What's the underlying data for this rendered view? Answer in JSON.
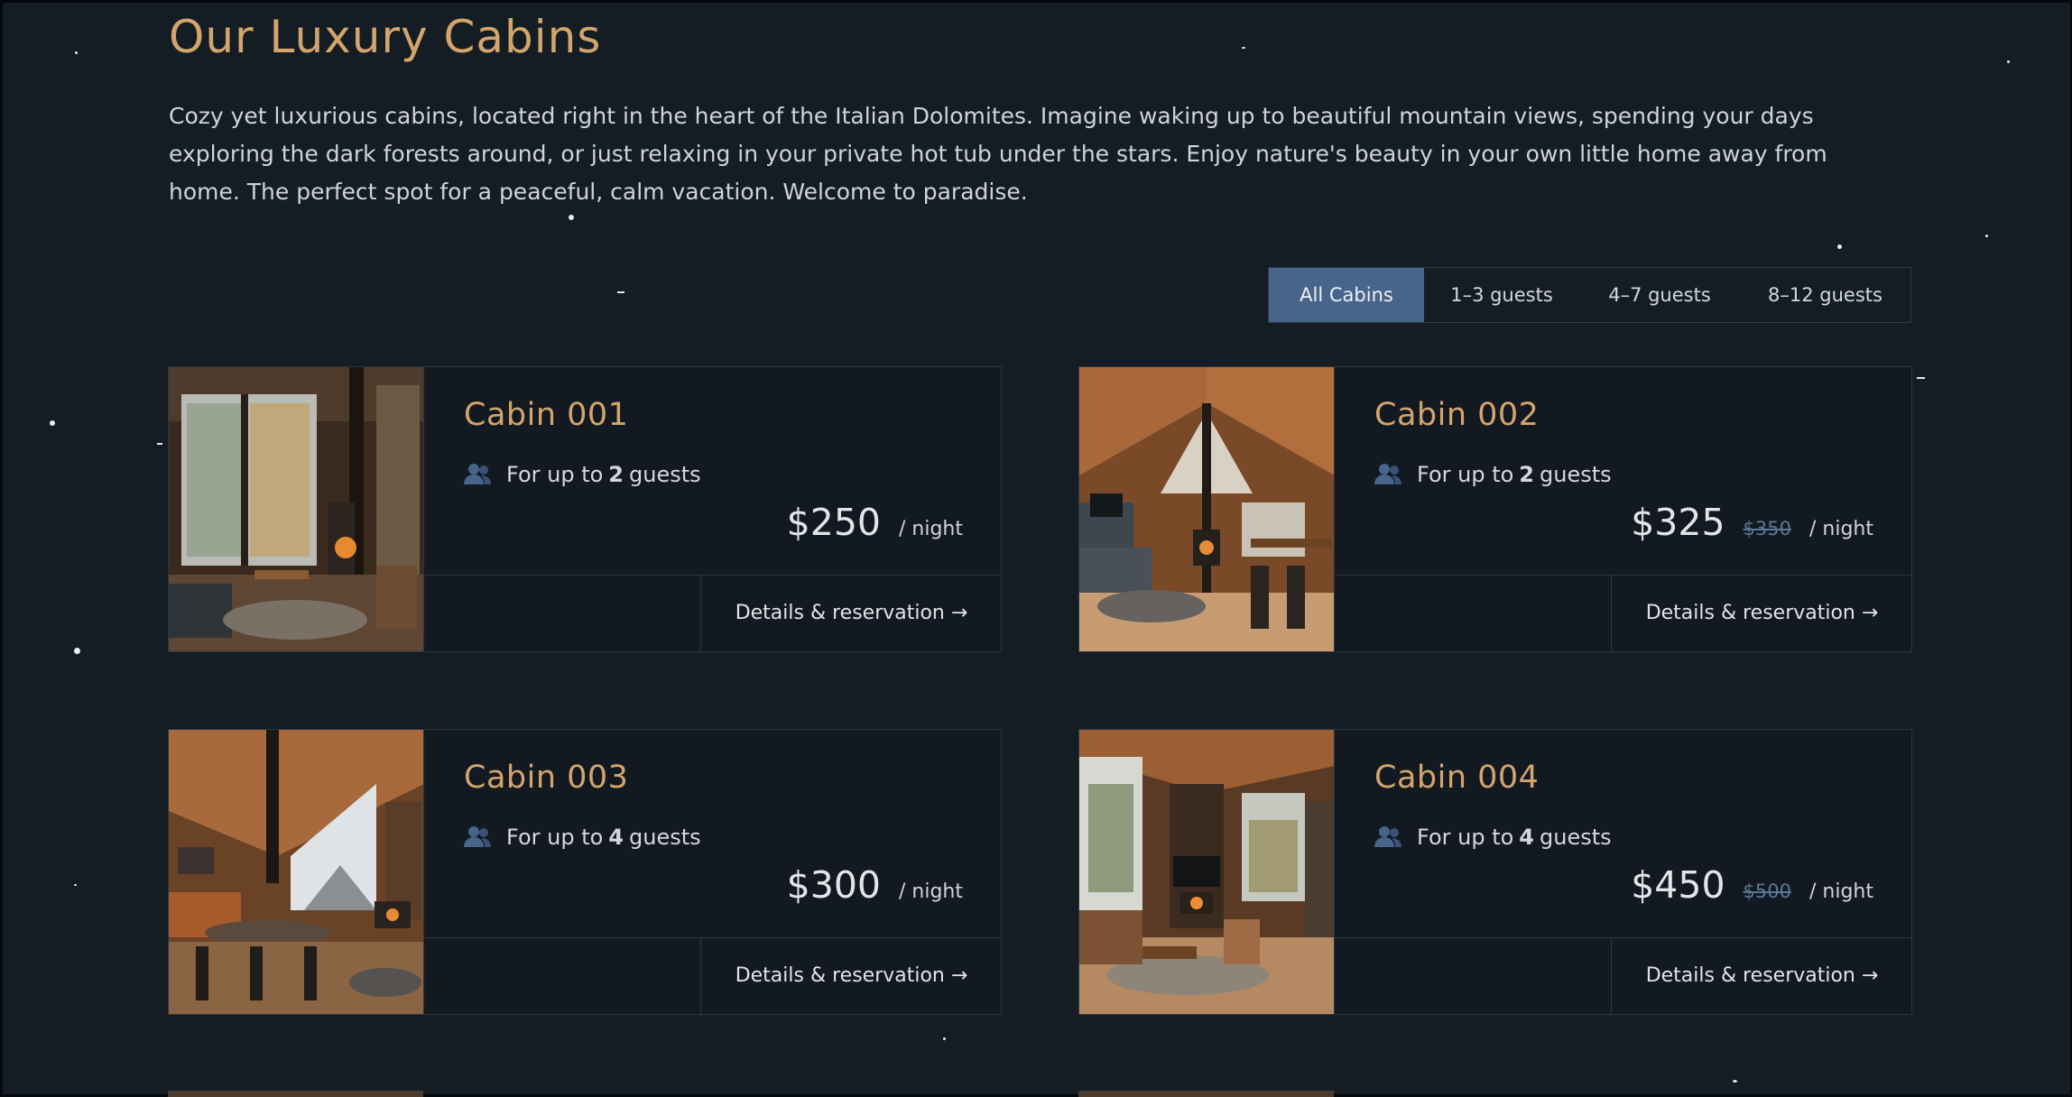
{
  "section": {
    "title": "Our Luxury Cabins",
    "intro": "Cozy yet luxurious cabins, located right in the heart of the Italian Dolomites. Imagine waking up to beautiful mountain views, spending your days exploring the dark forests around, or just relaxing in your private hot tub under the stars. Enjoy nature's beauty in your own little home away from home. The perfect spot for a peaceful, calm vacation. Welcome to paradise."
  },
  "filter": {
    "options": [
      "All Cabins",
      "1–3 guests",
      "4–7 guests",
      "8–12 guests"
    ],
    "active": "All Cabins"
  },
  "cabins": [
    {
      "name": "Cabin 001",
      "guests_prefix": "For up to",
      "guests_count": "2",
      "guests_suffix": "guests",
      "price": "$250",
      "old_price": "",
      "per_night": "/ night",
      "cta": "Details & reservation →"
    },
    {
      "name": "Cabin 002",
      "guests_prefix": "For up to",
      "guests_count": "2",
      "guests_suffix": "guests",
      "price": "$325",
      "old_price": "$350",
      "per_night": "/ night",
      "cta": "Details & reservation →"
    },
    {
      "name": "Cabin 003",
      "guests_prefix": "For up to",
      "guests_count": "4",
      "guests_suffix": "guests",
      "price": "$300",
      "old_price": "",
      "per_night": "/ night",
      "cta": "Details & reservation →"
    },
    {
      "name": "Cabin 004",
      "guests_prefix": "For up to",
      "guests_count": "4",
      "guests_suffix": "guests",
      "price": "$450",
      "old_price": "$500",
      "per_night": "/ night",
      "cta": "Details & reservation →"
    }
  ],
  "colors": {
    "accent": "#d3a56d",
    "active_filter": "#47648a",
    "background": "#141c24",
    "icon": "#47648a"
  },
  "icons": {
    "guests": "users-icon"
  }
}
